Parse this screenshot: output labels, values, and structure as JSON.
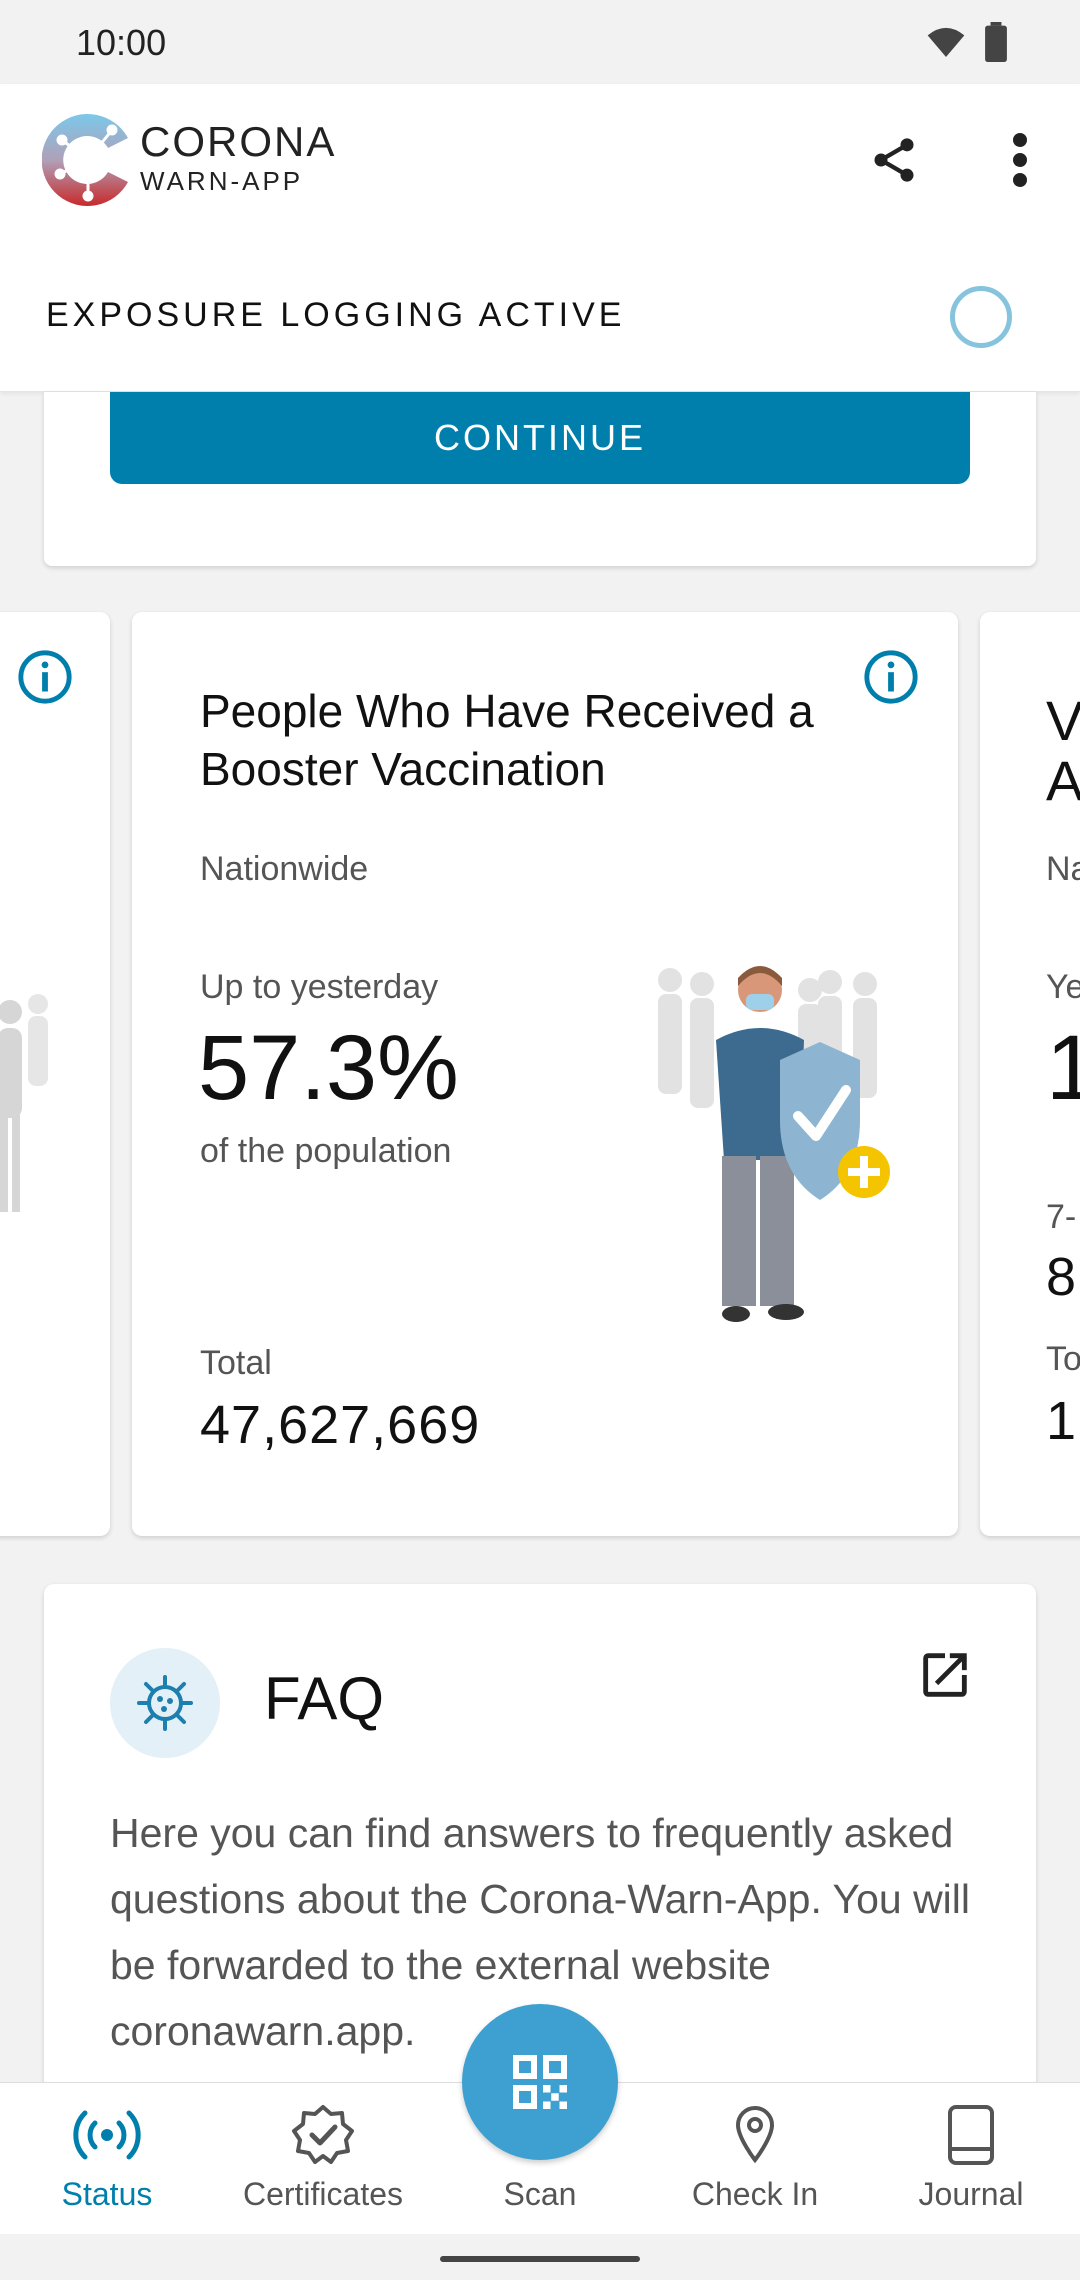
{
  "status_bar": {
    "time": "10:00"
  },
  "header": {
    "brand_line1": "CORONA",
    "brand_line2": "WARN-APP",
    "exposure_status": "EXPOSURE LOGGING ACTIVE"
  },
  "card_top": {
    "continue_label": "CONTINUE"
  },
  "stat_card": {
    "title": "People Who Have Received a Booster Vaccination",
    "region": "Nationwide",
    "period_label": "Up to yesterday",
    "percentage": "57.3%",
    "percentage_suffix": "of the population",
    "total_label": "Total",
    "total_value": "47,627,669"
  },
  "right_card_peek": {
    "title_fragment_1": "V",
    "title_fragment_2": "A",
    "region_fragment": "Na",
    "label1_fragment": "Ye",
    "value1_fragment": "1",
    "label2_fragment": "7-",
    "value2_fragment": "8",
    "label3_fragment": "To",
    "value3_fragment": "1"
  },
  "faq": {
    "title": "FAQ",
    "body": "Here you can find answers to frequently asked questions about the Corona-Warn-App. You will be forwarded to the external website coronawarn.app."
  },
  "bottom_nav": {
    "items": [
      {
        "label": "Status",
        "icon": "broadcast-icon",
        "active": true
      },
      {
        "label": "Certificates",
        "icon": "certificate-badge-icon",
        "active": false
      },
      {
        "label": "Scan",
        "icon": "qr-code-icon",
        "active": false
      },
      {
        "label": "Check In",
        "icon": "location-pin-icon",
        "active": false
      },
      {
        "label": "Journal",
        "icon": "book-icon",
        "active": false
      }
    ]
  },
  "colors": {
    "accent": "#007fad",
    "fab": "#3ea0d0",
    "ring": "#86c4dd",
    "booster_plus": "#f5c400"
  }
}
